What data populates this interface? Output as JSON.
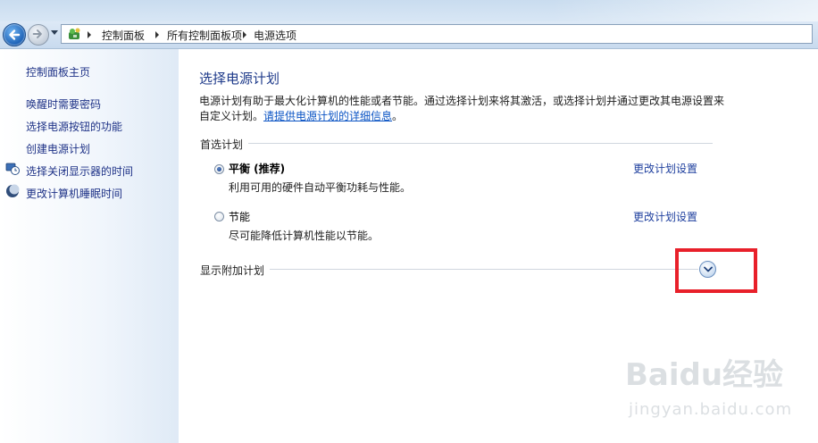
{
  "breadcrumb": [
    "控制面板",
    "所有控制面板项",
    "电源选项"
  ],
  "sidebar": {
    "home": "控制面板主页",
    "items": [
      {
        "label": "唤醒时需要密码"
      },
      {
        "label": "选择电源按钮的功能"
      },
      {
        "label": "创建电源计划"
      },
      {
        "label": "选择关闭显示器的时间"
      },
      {
        "label": "更改计算机睡眠时间"
      }
    ]
  },
  "main": {
    "title": "选择电源计划",
    "description": "电源计划有助于最大化计算机的性能或者节能。通过选择计划来将其激活，或选择计划并通过更改其电源设置来自定义计划。",
    "info_link": "请提供电源计划的详细信息",
    "desc_end": "。",
    "preferred_label": "首选计划",
    "plans": [
      {
        "name": "平衡 (推荐)",
        "description": "利用可用的硬件自动平衡功耗与性能。",
        "link": "更改计划设置",
        "selected": true
      },
      {
        "name": "节能",
        "description": "尽可能降低计算机性能以节能。",
        "link": "更改计划设置",
        "selected": false
      }
    ],
    "additional_label": "显示附加计划"
  },
  "watermark": {
    "brand": "Baidu经验",
    "sub": "jingyan.baidu.com"
  },
  "colors": {
    "highlight": "#e8202a",
    "link": "#1e3f9e",
    "title": "#1e3a8a"
  }
}
